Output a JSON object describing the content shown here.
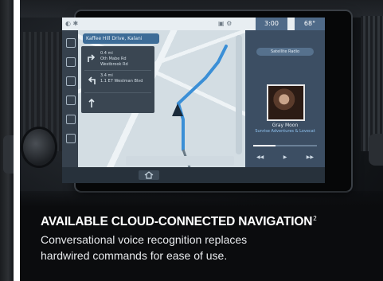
{
  "infotainment": {
    "status_left": "◐ ✱",
    "status_right": "▣ ⚙",
    "clock": "3:00",
    "temperature": "68°",
    "nav": {
      "search_text": "Kaffee Hill Drive, Kalani",
      "turns": [
        {
          "line1": "0.4 mi",
          "line2": "Oth Mabe Rd",
          "line3": "Westbrook Rd"
        },
        {
          "line1": "3.4 mi",
          "line2": "1.1 E7 Westman Blvd",
          "line3": ""
        },
        {
          "line1": "",
          "line2": "",
          "line3": ""
        }
      ]
    },
    "media": {
      "source_label": "Satellite Radio",
      "track_title": "Gray Moon",
      "artist": "Sunrise Adventures & Lovecat",
      "progress_fraction": 0.35,
      "controls": [
        "◀◀",
        "▶",
        "▶▶"
      ]
    },
    "bottom_bar": {
      "items": [
        "",
        "",
        "",
        "",
        "",
        "",
        "",
        ""
      ],
      "home_icon": "home-icon"
    },
    "colors": {
      "map_bg": "#d3dde3",
      "route_blue": "#3b8fd6",
      "media_bg": "#3c4e63"
    }
  },
  "caption": {
    "headline": "AVAILABLE CLOUD-CONNECTED NAVIGATION",
    "footnote": "2",
    "line1": "Conversational voice recognition replaces",
    "line2": "hardwired commands for ease of use."
  }
}
